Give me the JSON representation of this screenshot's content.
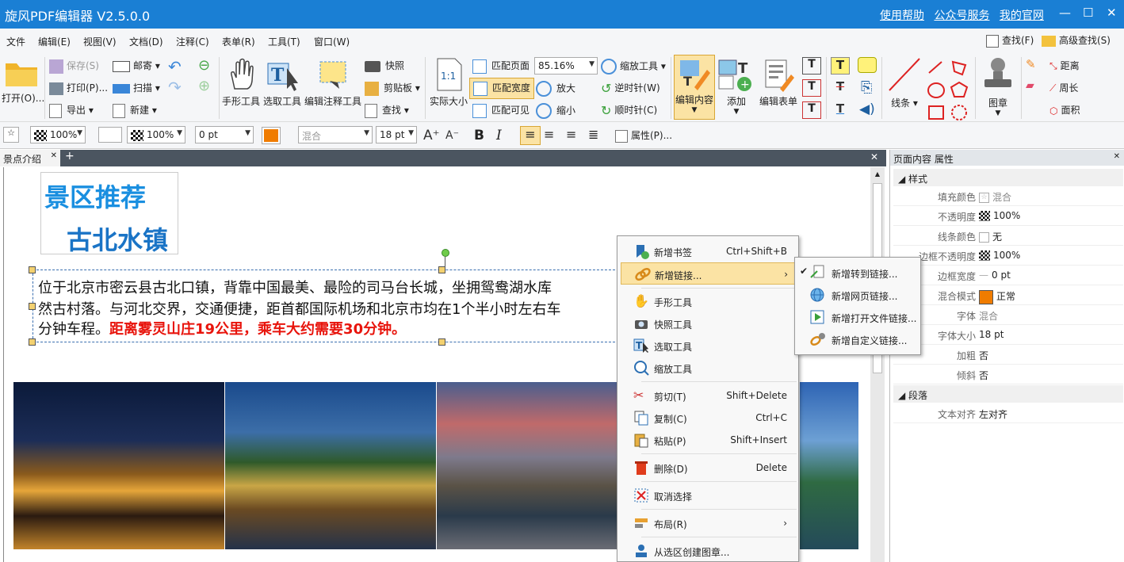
{
  "window": {
    "title": "旋风PDF编辑器 V2.5.0.0",
    "links": [
      "使用帮助",
      "公众号服务",
      "我的官网"
    ],
    "minimize": "—",
    "maximize": "☐",
    "close": "✕"
  },
  "menu": [
    "文件",
    "编辑(E)",
    "视图(V)",
    "文档(D)",
    "注释(C)",
    "表单(R)",
    "工具(T)",
    "窗口(W)"
  ],
  "menu_right": {
    "find": "查找(F)",
    "advanced_find": "高级查找(S)"
  },
  "ribbon": {
    "open": "打开(O)...",
    "save": "保存(S)",
    "print": "打印(P)...",
    "export": "导出",
    "mail": "邮寄",
    "scan": "扫描",
    "new": "新建",
    "hand_tool": "手形工具",
    "select_tool": "选取工具",
    "annot_tool": "编辑注释工具",
    "snapshot": "快照",
    "clipboard": "剪贴板",
    "find": "查找",
    "actual_size": "实际大小",
    "fit_page": "匹配页面",
    "fit_width": "匹配宽度",
    "fit_visible": "匹配可见",
    "zoom_value": "85.16%",
    "zoom_tool": "缩放工具",
    "zoom_in": "放大",
    "zoom_out": "缩小",
    "rotate_ccw": "逆时针(W)",
    "rotate_cw": "顺时针(C)",
    "edit_content": "编辑内容",
    "add": "添加",
    "edit_form": "编辑表单",
    "lines": "线条",
    "stamp": "图章",
    "distance": "距离",
    "perimeter": "周长",
    "area": "面积"
  },
  "format": {
    "opacity1": "100%",
    "opacity2": "100%",
    "line_width": "0 pt",
    "blend": "混合",
    "font_size": "18 pt",
    "properties": "属性(P)..."
  },
  "tab": {
    "label": "景点介绍",
    "close": "✕"
  },
  "document": {
    "heading1": "景区推荐",
    "heading2": "古北水镇",
    "line1": "位于北京市密云县古北口镇，背靠中国最美、最险的司马台长城，坐拥鸳鸯湖水库",
    "line2": "然古村落。与河北交界，交通便捷，距首都国际机场和北京市均在1个半小时左右车",
    "line3_black": "分钟车程。",
    "line3_red": "距离雾灵山庄19公里，乘车大约需要30分钟。"
  },
  "context_menu": {
    "items": [
      {
        "label": "新增书签",
        "shortcut": "Ctrl+Shift+B"
      },
      {
        "label": "新增链接...",
        "shortcut": "",
        "submenu": true
      },
      {
        "label": "手形工具",
        "shortcut": ""
      },
      {
        "label": "快照工具",
        "shortcut": ""
      },
      {
        "label": "选取工具",
        "shortcut": ""
      },
      {
        "label": "缩放工具",
        "shortcut": ""
      },
      {
        "label": "剪切(T)",
        "shortcut": "Shift+Delete"
      },
      {
        "label": "复制(C)",
        "shortcut": "Ctrl+C"
      },
      {
        "label": "粘贴(P)",
        "shortcut": "Shift+Insert"
      },
      {
        "label": "删除(D)",
        "shortcut": "Delete"
      },
      {
        "label": "取消选择",
        "shortcut": ""
      },
      {
        "label": "布局(R)",
        "shortcut": "",
        "submenu": true
      },
      {
        "label": "从选区创建图章...",
        "shortcut": ""
      }
    ],
    "arrow": "›"
  },
  "submenu": [
    "新增转到链接...",
    "新增网页链接...",
    "新增打开文件链接...",
    "新增自定义链接..."
  ],
  "properties": {
    "header": "页面内容 属性",
    "section_style": "样式",
    "rows": [
      {
        "key": "填充颜色",
        "value": "混合"
      },
      {
        "key": "不透明度",
        "value": "100%"
      },
      {
        "key": "线条颜色",
        "value": "无"
      },
      {
        "key": "边框不透明度",
        "value": "100%"
      },
      {
        "key": "边框宽度",
        "value": "0 pt"
      },
      {
        "key": "混合模式",
        "value": "正常"
      },
      {
        "key": "字体",
        "value": "混合"
      },
      {
        "key": "字体大小",
        "value": "18 pt"
      },
      {
        "key": "加粗",
        "value": "否"
      },
      {
        "key": "倾斜",
        "value": "否"
      }
    ],
    "section_para": "段落",
    "para_rows": [
      {
        "key": "文本对齐",
        "value": "左对齐"
      }
    ]
  },
  "colors": {
    "title_bar": "#1a7fd4",
    "heading": "#1a8fe0",
    "red_text": "#e8140c",
    "orange": "#f07c00"
  }
}
